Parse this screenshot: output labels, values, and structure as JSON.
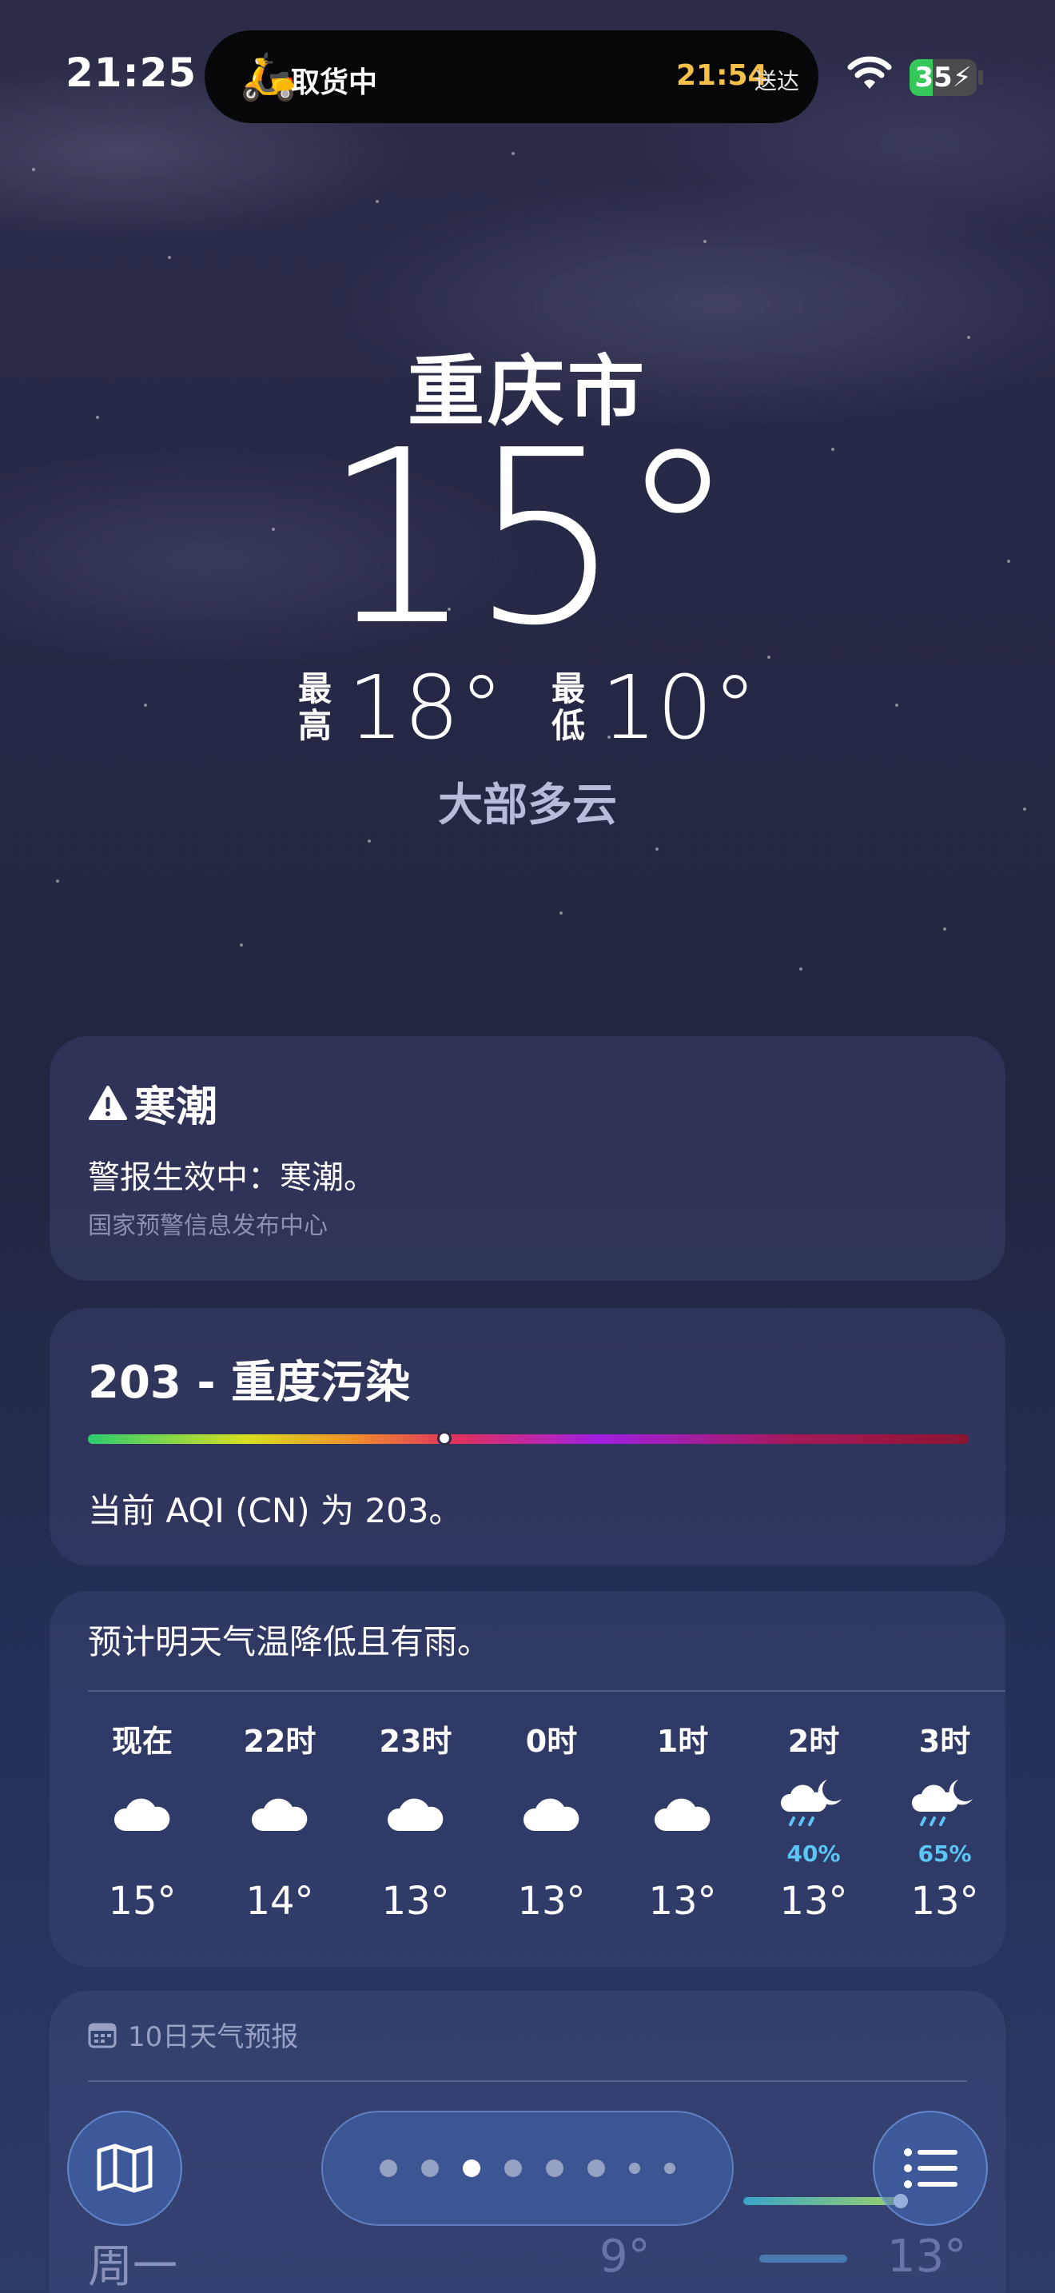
{
  "status_bar": {
    "time": "21:25",
    "live_activity": {
      "status": "取货中",
      "eta_time": "21:54",
      "eta_label": "送达",
      "icon": "delivery-scooter-icon"
    },
    "battery_level": "35",
    "battery_percent": 35
  },
  "weather": {
    "city": "重庆市",
    "current_temp": "15°",
    "high_label_1": "最",
    "high_label_2": "高",
    "high_temp": "18°",
    "low_label_1": "最",
    "low_label_2": "低",
    "low_temp": "10°",
    "condition": "大部多云"
  },
  "alert": {
    "title": "寒潮",
    "text": "警报生效中：寒潮。",
    "source": "国家预警信息发布中心",
    "icon": "warning-triangle-icon"
  },
  "aqi": {
    "title": "203 - 重度污染",
    "text": "当前 AQI (CN) 为 203。",
    "value": 203,
    "scale_position": 0.405
  },
  "hourly": {
    "summary": "预计明天气温降低且有雨。",
    "items": [
      {
        "label": "现在",
        "icon": "cloud-icon",
        "pop": "",
        "temp": "15°"
      },
      {
        "label": "22时",
        "icon": "cloud-icon",
        "pop": "",
        "temp": "14°"
      },
      {
        "label": "23时",
        "icon": "cloud-icon",
        "pop": "",
        "temp": "13°"
      },
      {
        "label": "0时",
        "icon": "cloud-icon",
        "pop": "",
        "temp": "13°"
      },
      {
        "label": "1时",
        "icon": "cloud-icon",
        "pop": "",
        "temp": "13°"
      },
      {
        "label": "2时",
        "icon": "cloud-moon-rain-icon",
        "pop": "40%",
        "temp": "13°"
      },
      {
        "label": "3时",
        "icon": "cloud-moon-rain-icon",
        "pop": "65%",
        "temp": "13°"
      }
    ]
  },
  "tenday": {
    "title": "10日天气预报",
    "icon": "calendar-icon",
    "row": {
      "day": "周一",
      "low": "9°",
      "high": "13°",
      "icon": "cloud-rain-icon"
    }
  },
  "toolbar": {
    "map_icon": "map-icon",
    "list_icon": "list-icon",
    "page_count": 8,
    "active_page": 2
  }
}
